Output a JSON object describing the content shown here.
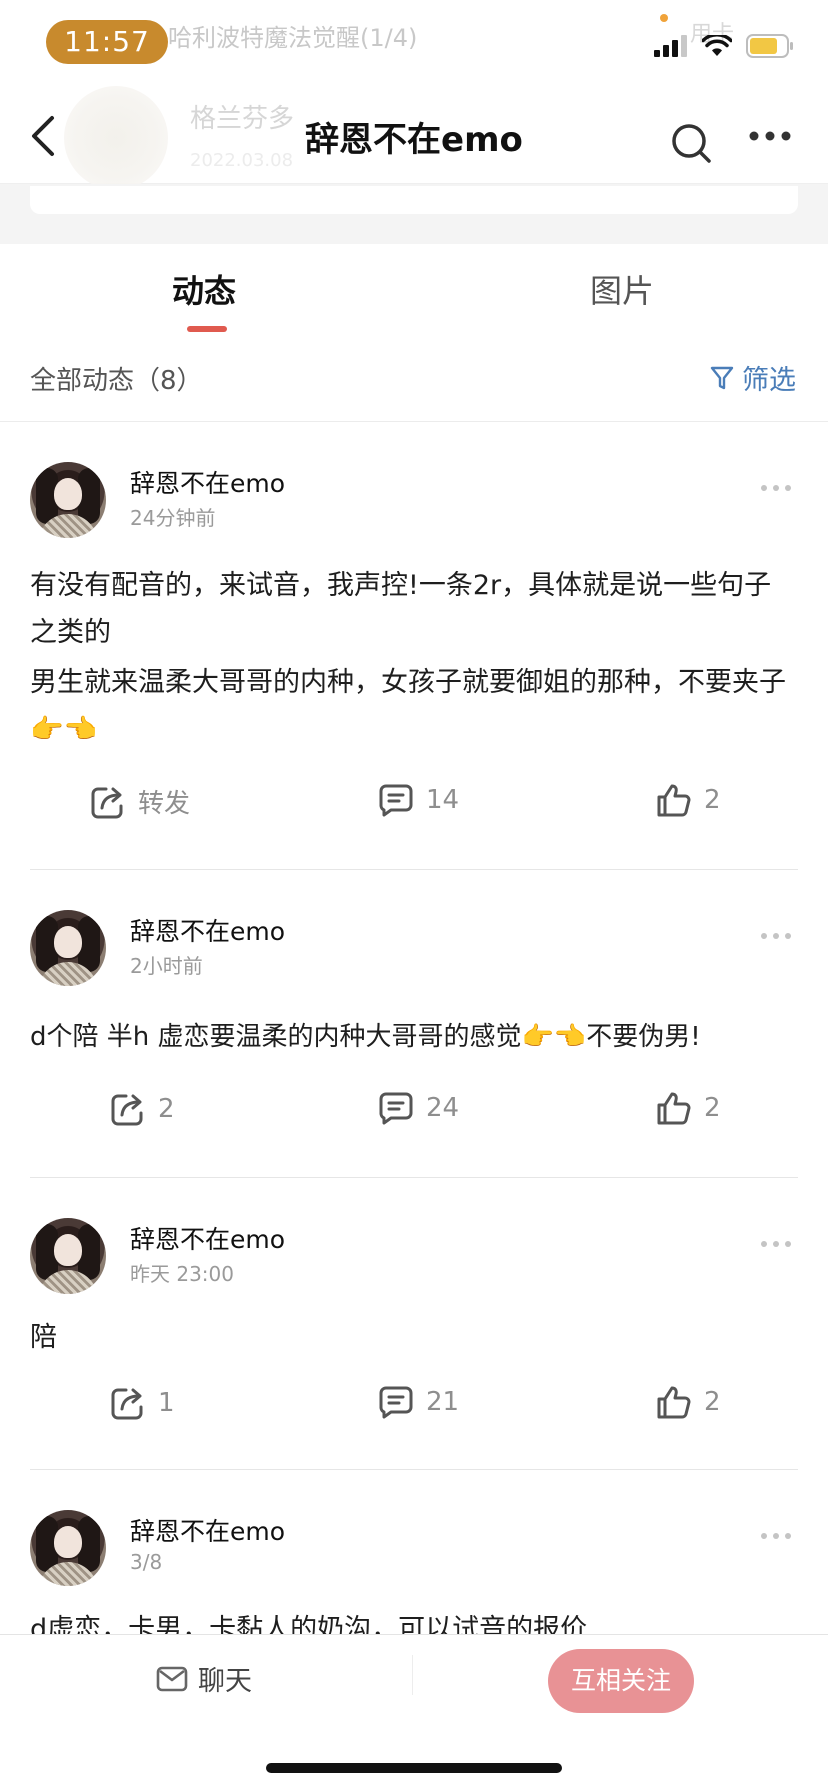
{
  "status_bar": {
    "time": "11:57",
    "behind_text": "哈利波特魔法觉醒(1/4)",
    "behind_right": "用卡",
    "icons": [
      "signal-icon",
      "wifi-icon",
      "battery-icon"
    ],
    "battery_color": "#f2c744"
  },
  "nav": {
    "title": "辞恩不在emo",
    "behind_name": "格兰芬多",
    "behind_date": "2022.03.08",
    "icons": [
      "back-icon",
      "search-icon",
      "more-icon"
    ]
  },
  "tabs": [
    {
      "label": "动态",
      "active": true
    },
    {
      "label": "图片",
      "active": false
    }
  ],
  "filter": {
    "count_label": "全部动态（8）",
    "filter_label": "筛选"
  },
  "posts": [
    {
      "user": "辞恩不在emo",
      "time": "24分钟前",
      "lines": [
        "有没有配音的，来试音，我声控!一条2r，具体就是说一些句子之类的",
        "男生就来温柔大哥哥的内种，女孩子就要御姐的那种，不要夹子👉👈"
      ],
      "repost": "转发",
      "comments": "14",
      "likes": "2"
    },
    {
      "user": "辞恩不在emo",
      "time": "2小时前",
      "lines": [
        "d个陪 半h 虚恋要温柔的内种大哥哥的感觉👉👈不要伪男!"
      ],
      "repost": "2",
      "comments": "24",
      "likes": "2"
    },
    {
      "user": "辞恩不在emo",
      "time": "昨天 23:00",
      "lines": [
        "陪"
      ],
      "repost": "1",
      "comments": "21",
      "likes": "2"
    },
    {
      "user": "辞恩不在emo",
      "time": "3/8",
      "lines": [
        "d虚恋，卡男，卡黏人的奶沟，可以试音的报价"
      ],
      "repost": "",
      "comments": "",
      "likes": ""
    }
  ],
  "bottom": {
    "chat": "聊天",
    "follow": "互相关注"
  },
  "colors": {
    "accent_red": "#e05a4f",
    "filter_blue": "#4a7db8",
    "follow_pink": "#e89295",
    "time_pill": "#c88a2d"
  }
}
